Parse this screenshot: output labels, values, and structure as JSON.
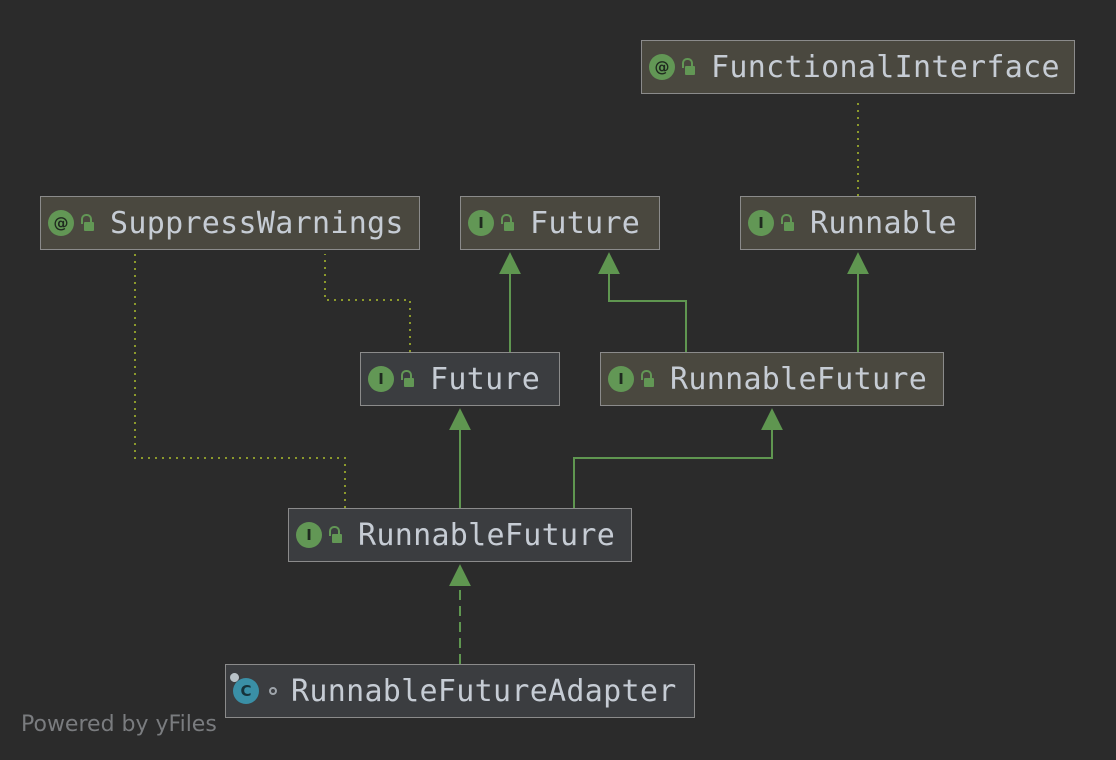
{
  "nodes": {
    "functional_interface": {
      "label": "FunctionalInterface",
      "kind": "annotation",
      "icon": "annotation-icon",
      "icon_glyph": "@"
    },
    "suppress_warnings": {
      "label": "SuppressWarnings",
      "kind": "annotation",
      "icon": "annotation-icon",
      "icon_glyph": "@"
    },
    "future_lib": {
      "label": "Future",
      "kind": "interface",
      "icon": "interface-icon",
      "icon_glyph": "I"
    },
    "runnable": {
      "label": "Runnable",
      "kind": "interface",
      "icon": "interface-icon",
      "icon_glyph": "I"
    },
    "future_proj": {
      "label": "Future",
      "kind": "interface",
      "icon": "interface-icon",
      "icon_glyph": "I"
    },
    "runnable_future_lib": {
      "label": "RunnableFuture",
      "kind": "interface",
      "icon": "interface-icon",
      "icon_glyph": "I"
    },
    "runnable_future_proj": {
      "label": "RunnableFuture",
      "kind": "interface",
      "icon": "interface-icon",
      "icon_glyph": "I"
    },
    "adapter": {
      "label": "RunnableFutureAdapter",
      "kind": "class",
      "icon": "class-icon",
      "icon_glyph": "C"
    }
  },
  "edges": [
    {
      "from": "runnable",
      "to": "functional_interface",
      "type": "annotation"
    },
    {
      "from": "future_proj",
      "to": "suppress_warnings",
      "type": "annotation"
    },
    {
      "from": "runnable_future_proj",
      "to": "suppress_warnings",
      "type": "annotation"
    },
    {
      "from": "future_proj",
      "to": "future_lib",
      "type": "extends"
    },
    {
      "from": "runnable_future_lib",
      "to": "future_lib",
      "type": "extends"
    },
    {
      "from": "runnable_future_lib",
      "to": "runnable",
      "type": "extends"
    },
    {
      "from": "runnable_future_proj",
      "to": "future_proj",
      "type": "extends"
    },
    {
      "from": "runnable_future_proj",
      "to": "runnable_future_lib",
      "type": "extends"
    },
    {
      "from": "adapter",
      "to": "runnable_future_proj",
      "type": "implements"
    }
  ],
  "colors": {
    "background": "#2b2b2b",
    "edge": "#5f9650",
    "annotation_edge": "#8c9a2c",
    "library_node": "#4a483f",
    "project_node": "#3b3d40"
  },
  "watermark": "Powered by yFiles"
}
